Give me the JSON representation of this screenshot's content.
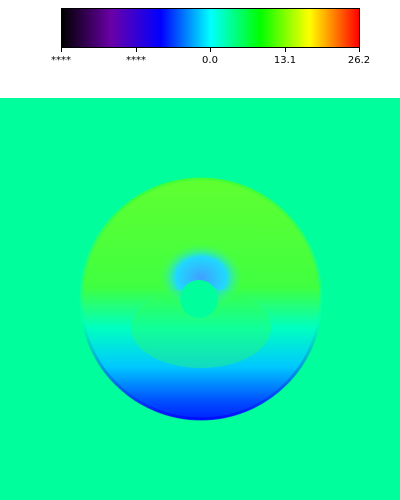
{
  "colorbar": {
    "tick_labels": [
      "****",
      "****",
      "0.0",
      "13.1",
      "26.2"
    ],
    "colors": [
      "#000000",
      "#6a00a8",
      "#0000ff",
      "#00ffff",
      "#00ff00",
      "#ffff00",
      "#ff0000"
    ]
  },
  "field": {
    "background_color": "#00ff9c",
    "outer_ring_color": "#50ff40",
    "inner_low_color": "#1ab4ff",
    "low_edge_color": "#0030ff",
    "hole_color": "#00ff9c"
  }
}
